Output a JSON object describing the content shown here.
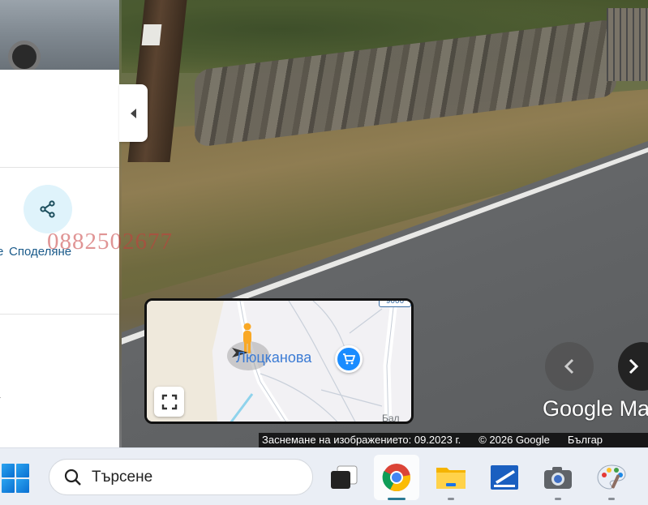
{
  "watermark": "0882502677",
  "side_panel": {
    "share_label": "Споделяне",
    "partial_label": "е"
  },
  "minimap": {
    "place_label": "Люцканова",
    "road_badge": "9006",
    "partial_label": "Бал"
  },
  "branding": {
    "logo_text": "Google Ma"
  },
  "attribution": {
    "capture_date": "Заснемане на изображението: 09.2023 г.",
    "copyright": "© 2026 Google",
    "language": "Българ"
  },
  "taskbar": {
    "search_placeholder": "Търсене"
  },
  "colors": {
    "accent": "#1a8cff",
    "taskbar_bg": "#eaeef5",
    "share_bg": "#dff3fb"
  }
}
